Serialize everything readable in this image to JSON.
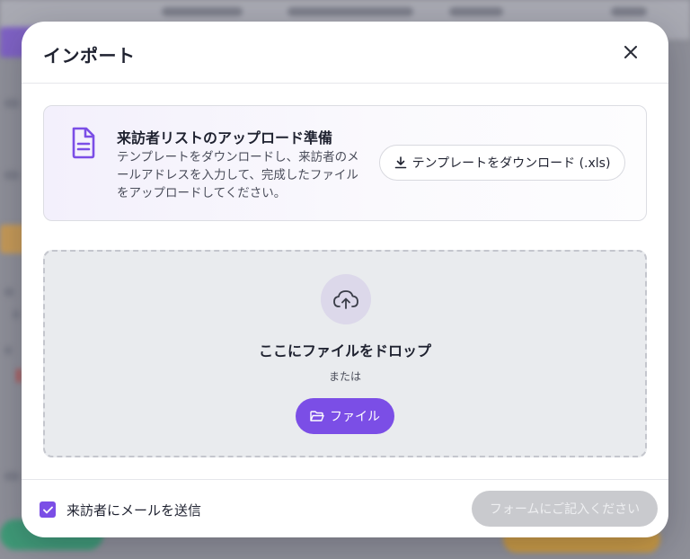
{
  "colors": {
    "accent": "#7b4ee6",
    "disabled": "#c9cace",
    "overlay": "#8f9099"
  },
  "modal": {
    "title": "インポート",
    "close_icon": "close-icon"
  },
  "info_card": {
    "icon": "document-icon",
    "title": "来訪者リストのアップロード準備",
    "description": "テンプレートをダウンロードし、来訪者のメールアドレスを入力して、完成したファイルをアップロードしてください。",
    "download_button": {
      "icon": "download-icon",
      "label": "テンプレートをダウンロード (.xls)"
    }
  },
  "dropzone": {
    "icon": "cloud-upload-icon",
    "title": "ここにファイルをドロップ",
    "or_text": "または",
    "file_button": {
      "icon": "folder-open-icon",
      "label": "ファイル"
    }
  },
  "footer": {
    "checkbox_checked": true,
    "checkbox_label": "来訪者にメールを送信",
    "submit_label": "フォームにご記入ください",
    "submit_disabled": true
  }
}
